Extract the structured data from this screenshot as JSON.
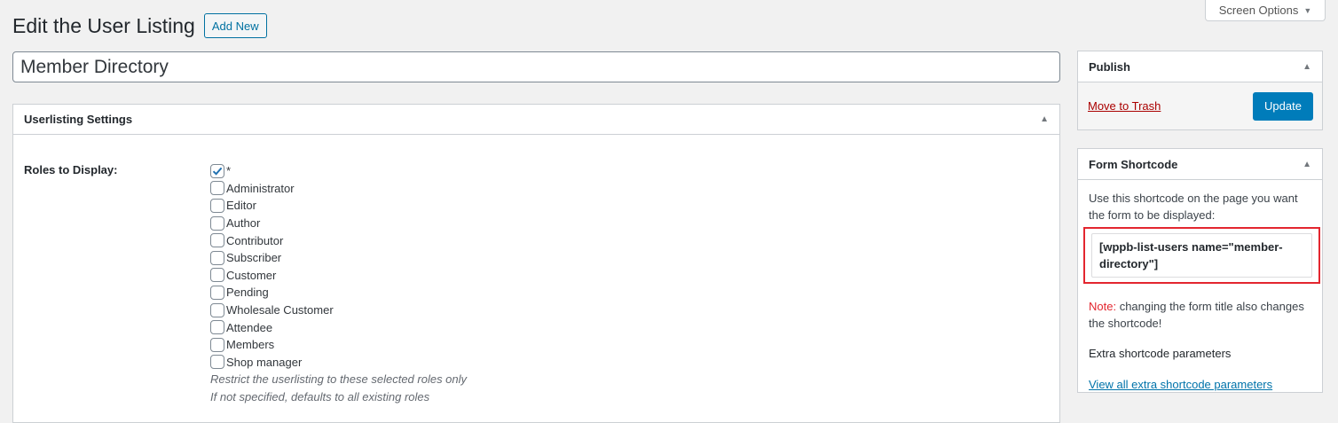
{
  "screen_options": {
    "label": "Screen Options"
  },
  "header": {
    "title": "Edit the User Listing",
    "add_new_label": "Add New"
  },
  "title_field": {
    "value": "Member Directory"
  },
  "settings_box": {
    "title": "Userlisting Settings",
    "roles_label": "Roles to Display:",
    "roles": [
      {
        "label": "*",
        "checked": true
      },
      {
        "label": "Administrator",
        "checked": false
      },
      {
        "label": "Editor",
        "checked": false
      },
      {
        "label": "Author",
        "checked": false
      },
      {
        "label": "Contributor",
        "checked": false
      },
      {
        "label": "Subscriber",
        "checked": false
      },
      {
        "label": "Customer",
        "checked": false
      },
      {
        "label": "Pending",
        "checked": false
      },
      {
        "label": "Wholesale Customer",
        "checked": false
      },
      {
        "label": "Attendee",
        "checked": false
      },
      {
        "label": "Members",
        "checked": false
      },
      {
        "label": "Shop manager",
        "checked": false
      }
    ],
    "description_1": "Restrict the userlisting to these selected roles only",
    "description_2": "If not specified, defaults to all existing roles"
  },
  "publish_box": {
    "title": "Publish",
    "trash_label": "Move to Trash",
    "update_label": "Update"
  },
  "shortcode_box": {
    "title": "Form Shortcode",
    "intro": "Use this shortcode on the page you want the form to be displayed:",
    "shortcode": "[wppb-list-users name=\"member-directory\"]",
    "note_label": "Note:",
    "note_text": " changing the form title also changes the shortcode!",
    "extra_title": "Extra shortcode parameters",
    "extra_link": "View all extra shortcode parameters"
  },
  "colors": {
    "accent": "#007cba",
    "link": "#0073aa",
    "danger": "#a00",
    "highlight": "#e3262f"
  }
}
